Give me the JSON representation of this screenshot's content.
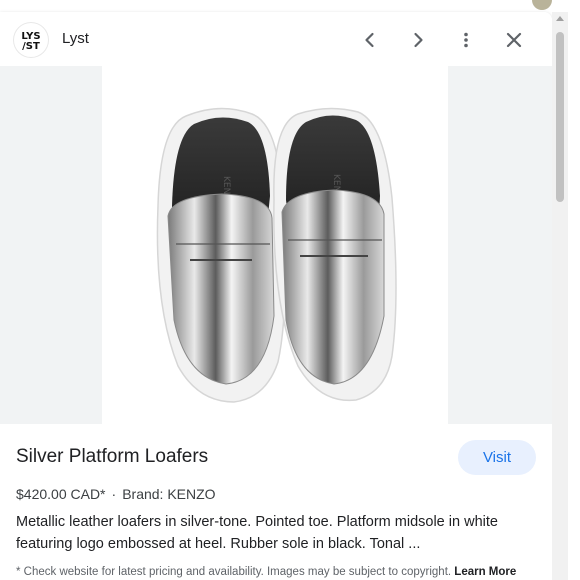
{
  "header": {
    "logo_text": "LYST",
    "site_name": "Lyst"
  },
  "product": {
    "title": "Silver Platform Loafers",
    "price": "$420.00 CAD*",
    "brand": "Brand: KENZO",
    "description": "Metallic leather loafers in silver-tone. Pointed toe. Platform midsole in white featuring logo embossed at heel. Rubber sole in black. Tonal ...",
    "visit_label": "Visit",
    "image_alt": "Silver platform loafers",
    "insole_text": "KENZO"
  },
  "disclaimer": {
    "text": "* Check website for latest pricing and availability. Images may be subject to copyright.",
    "learn_more": "Learn More"
  },
  "icons": {
    "back": "chevron-left-icon",
    "forward": "chevron-right-icon",
    "more": "more-vertical-icon",
    "close": "close-icon"
  },
  "colors": {
    "accent": "#1a73e8",
    "visit_bg": "#e8f0fe",
    "image_bg": "#f1f3f4"
  }
}
